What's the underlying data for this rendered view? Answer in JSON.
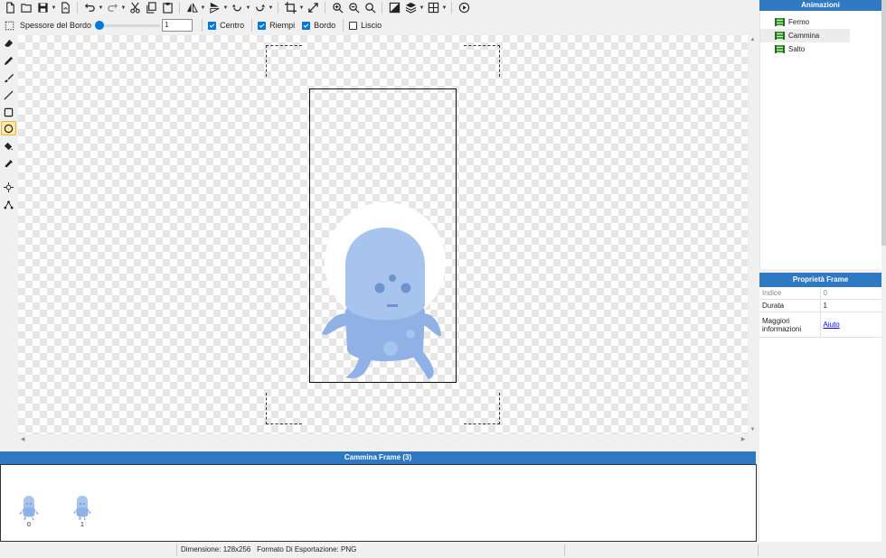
{
  "toolbar": {
    "buttons": [
      "new-file-icon",
      "open-folder-icon",
      "save-icon",
      "export-icon",
      "undo-icon",
      "redo-icon",
      "cut-icon",
      "copy-icon",
      "paste-icon",
      "flip-horizontal-icon",
      "flip-vertical-icon",
      "rotate-left-icon",
      "rotate-right-icon",
      "crop-icon",
      "resize-icon",
      "zoom-in-icon",
      "zoom-out-icon",
      "zoom-reset-icon",
      "color-adjust-icon",
      "layers-icon",
      "grid-icon",
      "play-icon"
    ]
  },
  "options": {
    "border_label": "Spessore del Bordo",
    "border_value": "1",
    "border_slider_fraction": 0.0,
    "center_label": "Centro",
    "center_checked": true,
    "fill_label": "Riempi",
    "fill_checked": true,
    "border_check_label": "Bordo",
    "border_checked": true,
    "smooth_label": "Liscio",
    "smooth_checked": false
  },
  "tools": [
    "eraser-icon",
    "pencil-icon",
    "brush-icon",
    "line-icon",
    "rectangle-icon",
    "ellipse-icon",
    "bucket-fill-icon",
    "eyedropper-icon",
    "move-point-icon",
    "node-icon"
  ],
  "active_tool": "ellipse-icon",
  "animations": {
    "title": "Animazioni",
    "items": [
      {
        "label": "Fermo",
        "selected": false
      },
      {
        "label": "Cammina",
        "selected": true
      },
      {
        "label": "Salto",
        "selected": false
      }
    ]
  },
  "frame_props": {
    "title": "Proprietà Frame",
    "rows": [
      {
        "key": "Indice",
        "value": "0"
      },
      {
        "key": "Durata",
        "value": "1"
      },
      {
        "key": "Maggiori informazioni",
        "value": "Aiuto"
      }
    ]
  },
  "strip": {
    "title": "Cammina Frame (3)",
    "frames": [
      "0",
      "1"
    ]
  },
  "status": {
    "dimension": "Dimensione: 128x256",
    "export_format": "Formato Di Esportazione: PNG"
  },
  "colors": {
    "accent": "#2f79c2",
    "character_body": "#8fb1e6",
    "character_head": "#a7c4ef",
    "character_dark": "#6f93cf"
  }
}
